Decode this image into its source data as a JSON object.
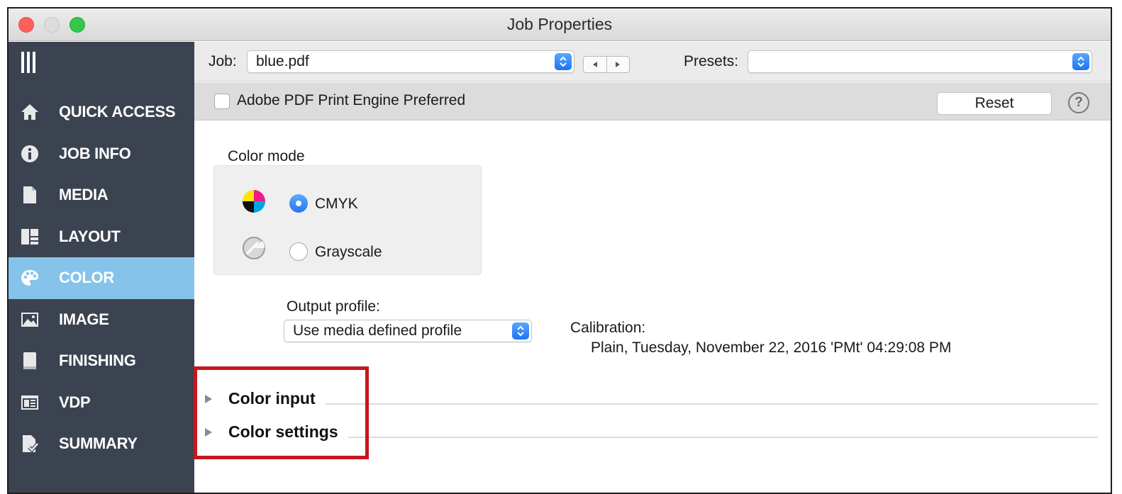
{
  "window": {
    "title": "Job Properties"
  },
  "sidebar": {
    "items": [
      {
        "label": "QUICK ACCESS",
        "icon": "home-icon",
        "active": false
      },
      {
        "label": "JOB INFO",
        "icon": "info-icon",
        "active": false
      },
      {
        "label": "MEDIA",
        "icon": "document-icon",
        "active": false
      },
      {
        "label": "LAYOUT",
        "icon": "layout-icon",
        "active": false
      },
      {
        "label": "COLOR",
        "icon": "palette-icon",
        "active": true
      },
      {
        "label": "IMAGE",
        "icon": "image-icon",
        "active": false
      },
      {
        "label": "FINISHING",
        "icon": "book-icon",
        "active": false
      },
      {
        "label": "VDP",
        "icon": "vdp-icon",
        "active": false
      },
      {
        "label": "SUMMARY",
        "icon": "summary-icon",
        "active": false
      }
    ],
    "active_color": "#86c3eb",
    "background_color": "#3c4350"
  },
  "jobbar": {
    "job_label": "Job:",
    "job_value": "blue.pdf",
    "presets_label": "Presets:",
    "presets_value": ""
  },
  "engine": {
    "checkbox_label": "Adobe PDF Print Engine Preferred",
    "checked": false,
    "reset_label": "Reset",
    "help_label": "?"
  },
  "color_mode": {
    "title": "Color mode",
    "options": [
      {
        "label": "CMYK",
        "selected": true
      },
      {
        "label": "Grayscale",
        "selected": false
      }
    ]
  },
  "output_profile": {
    "label": "Output profile:",
    "value": "Use media defined profile"
  },
  "calibration": {
    "label": "Calibration:",
    "value": "Plain, Tuesday, November 22, 2016 'PMt' 04:29:08 PM"
  },
  "sections": [
    {
      "title": "Color input",
      "expanded": false
    },
    {
      "title": "Color settings",
      "expanded": false
    }
  ],
  "highlight_color": "#c8161d"
}
